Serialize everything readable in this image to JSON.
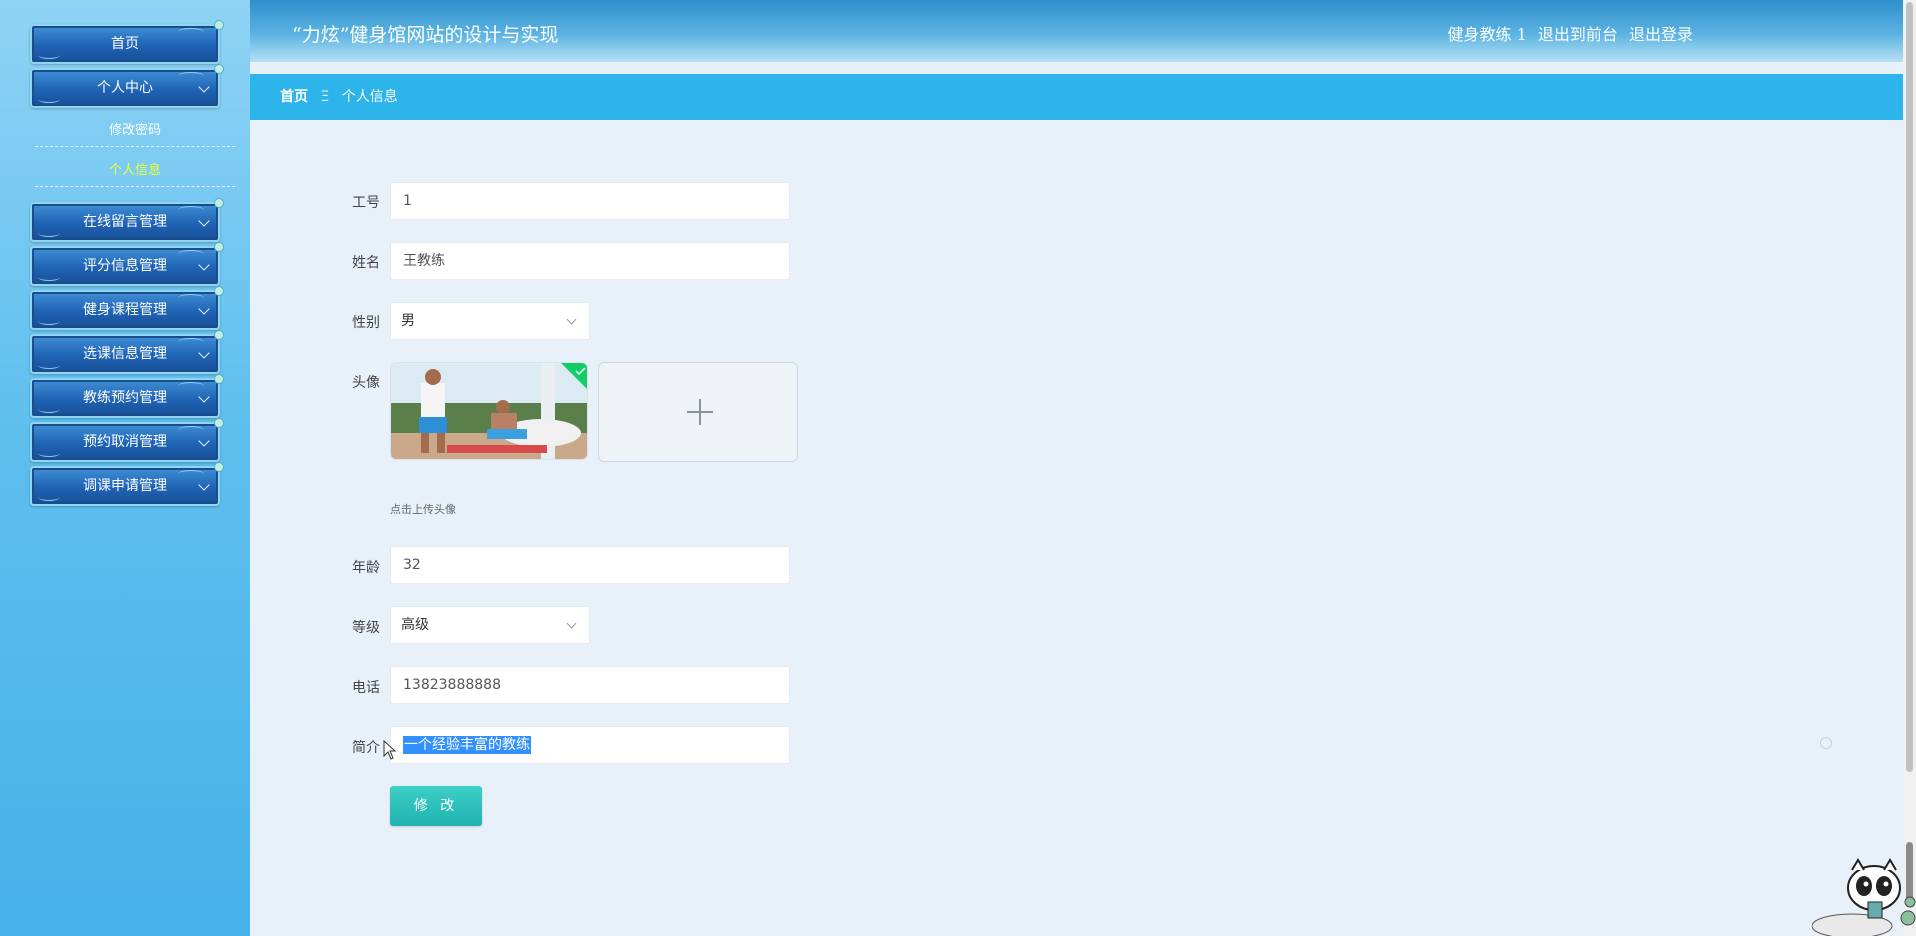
{
  "header": {
    "title": "“力炫”健身馆网站的设计与实现",
    "user": "健身教练 1",
    "to_front": "退出到前台",
    "logout": "退出登录"
  },
  "breadcrumb": {
    "home": "首页",
    "separator": "Ξ",
    "current": "个人信息"
  },
  "sidebar": {
    "home": "首页",
    "personal_center": "个人中心",
    "sub_items": [
      "修改密码",
      "个人信息"
    ],
    "items": [
      "在线留言管理",
      "评分信息管理",
      "健身课程管理",
      "选课信息管理",
      "教练预约管理",
      "预约取消管理",
      "调课申请管理"
    ]
  },
  "form": {
    "id_label": "工号",
    "id_value": "1",
    "name_label": "姓名",
    "name_value": "王教练",
    "gender_label": "性别",
    "gender_value": "男",
    "avatar_label": "头像",
    "avatar_tip": "点击上传头像",
    "age_label": "年龄",
    "age_value": "32",
    "level_label": "等级",
    "level_value": "高级",
    "phone_label": "电话",
    "phone_value": "13823888888",
    "intro_label": "简介",
    "intro_value": "一个经验丰富的教练",
    "submit": "修 改"
  },
  "colors": {
    "header_blue": "#2f8fcb",
    "breadcrumb_blue": "#2db4ea",
    "submit_teal": "#1fb2b0",
    "active_submenu": "#ecff3a"
  }
}
